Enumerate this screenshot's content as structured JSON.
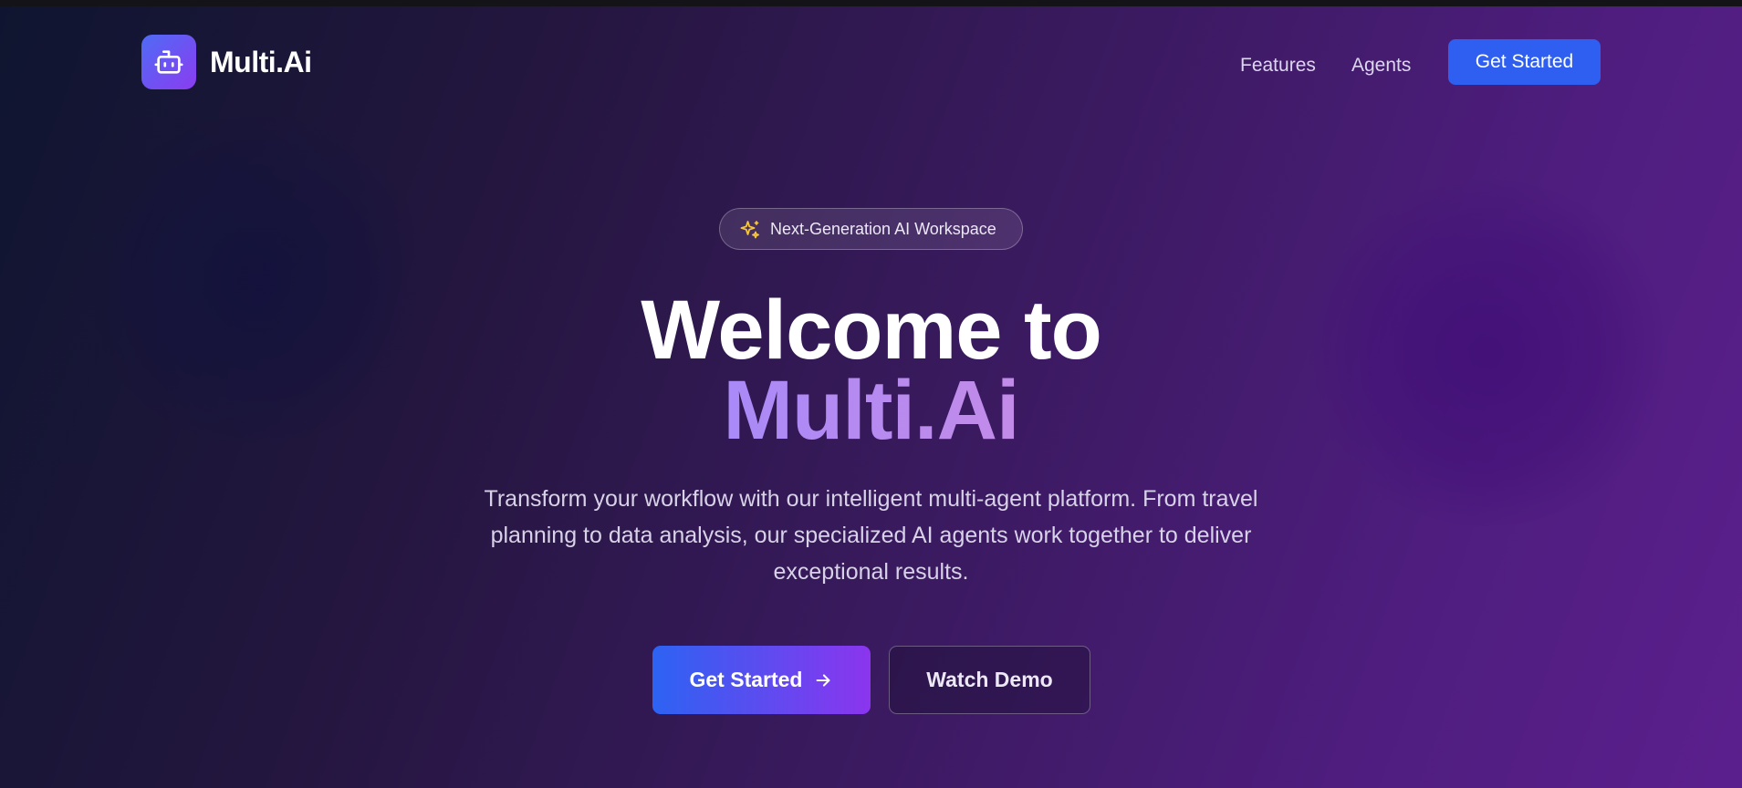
{
  "nav": {
    "brand": "Multi.Ai",
    "logo_icon": "robot-icon",
    "links": [
      "Features",
      "Agents"
    ],
    "cta_label": "Get Started"
  },
  "badge": {
    "icon": "sparkles-icon",
    "text": "Next-Generation AI Workspace"
  },
  "hero": {
    "title_line1": "Welcome to",
    "title_line2": "Multi.Ai",
    "subtitle": "Transform your workflow with our intelligent multi-agent platform. From travel planning to data analysis, our specialized AI agents work together to deliver exceptional results."
  },
  "cta": {
    "primary_label": "Get Started",
    "primary_icon": "arrow-right-icon",
    "secondary_label": "Watch Demo"
  },
  "colors": {
    "accent_blue": "#2f5ff0",
    "accent_purple": "#8b35ee",
    "badge_icon": "#f5c542"
  }
}
